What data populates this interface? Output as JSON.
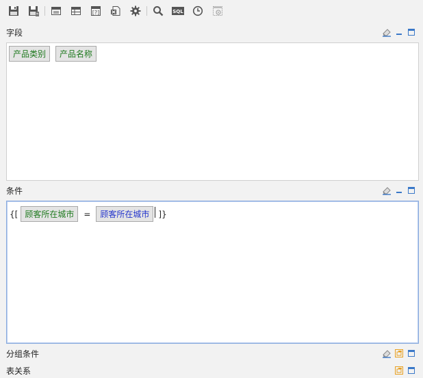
{
  "toolbar": {
    "buttons": [
      {
        "icon": "save-icon"
      },
      {
        "icon": "save-as-icon"
      },
      {
        "icon": "layout-icon"
      },
      {
        "icon": "table-layout-icon"
      },
      {
        "icon": "param-icon"
      },
      {
        "icon": "excel-export-icon"
      },
      {
        "icon": "gear-icon"
      },
      {
        "icon": "search-icon"
      },
      {
        "icon": "sql-icon",
        "label": "SQL"
      },
      {
        "icon": "clock-icon"
      },
      {
        "icon": "settings-disabled-icon"
      }
    ]
  },
  "sections": {
    "fields": {
      "title": "字段",
      "chips": [
        "产品类别",
        "产品名称"
      ]
    },
    "conditions": {
      "title": "条件",
      "open_brace": "{[",
      "left_field": "顾客所在城市",
      "operator": "=",
      "right_field": "顾客所在城市",
      "close_brace": "]}"
    },
    "group_conditions": {
      "title": "分组条件"
    },
    "relations": {
      "title": "表关系"
    }
  },
  "colors": {
    "background": "#f2f2f2",
    "panel_border": "#cfcfcf",
    "focused_border": "#88aadd",
    "chip_green_text": "#1f7a1f",
    "chip_blue_text": "#2233cc",
    "restore_icon": "#e8a020",
    "window_icon": "#3a78c8"
  }
}
